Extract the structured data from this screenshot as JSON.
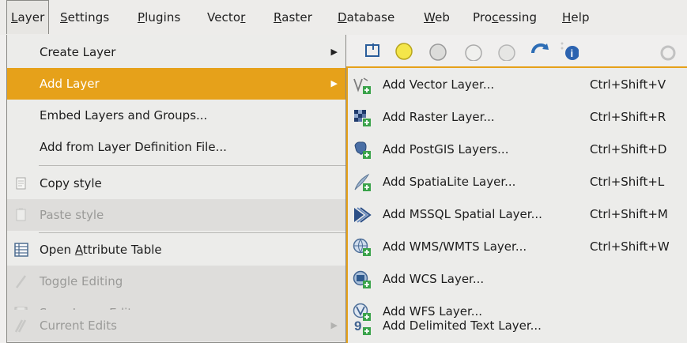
{
  "menubar": {
    "items": [
      {
        "label": "Layer",
        "mn": "L",
        "rest": "ayer",
        "open": true
      },
      {
        "label": "Settings",
        "mn": "S",
        "rest": "ettings"
      },
      {
        "label": "Plugins",
        "mn": "P",
        "rest": "lugins"
      },
      {
        "label": "Vector",
        "pre": "Vecto",
        "mn": "r",
        "rest": ""
      },
      {
        "label": "Raster",
        "mn": "R",
        "rest": "aster"
      },
      {
        "label": "Database",
        "mn": "D",
        "rest": "atabase"
      },
      {
        "label": "Web",
        "mn": "W",
        "rest": "eb"
      },
      {
        "label": "Processing",
        "pre": "Pro",
        "mn": "c",
        "rest": "essing"
      },
      {
        "label": "Help",
        "mn": "H",
        "rest": "elp"
      }
    ]
  },
  "layer_menu": {
    "items": [
      {
        "label": "Create Layer",
        "submenu": true
      },
      {
        "label": "Add Layer",
        "submenu": true,
        "state": "active"
      },
      {
        "label": "Embed Layers and Groups..."
      },
      {
        "label": "Add from Layer Definition File..."
      },
      {
        "label": "Copy style",
        "icon": "copy-style-icon"
      },
      {
        "label": "Paste style",
        "icon": "paste-style-icon",
        "state": "disabled"
      },
      {
        "label_pre": "Open ",
        "label_mn": "A",
        "label_post": "ttribute Table",
        "icon": "attribute-table-icon"
      },
      {
        "label": "Toggle Editing",
        "icon": "pencil-icon",
        "state": "disabled"
      },
      {
        "label": "Save Layer Edits",
        "icon": "save-edits-icon",
        "state": "disabled"
      },
      {
        "label": "Current Edits",
        "icon": "current-edits-icon",
        "state": "disabled",
        "submenu": true
      }
    ]
  },
  "add_layer_submenu": {
    "items": [
      {
        "label": "Add Vector Layer...",
        "shortcut": "Ctrl+Shift+V",
        "icon": "vector-layer-icon"
      },
      {
        "label": "Add Raster Layer...",
        "shortcut": "Ctrl+Shift+R",
        "icon": "raster-layer-icon"
      },
      {
        "label": "Add PostGIS Layers...",
        "shortcut": "Ctrl+Shift+D",
        "icon": "postgis-icon"
      },
      {
        "label": "Add SpatiaLite Layer...",
        "shortcut": "Ctrl+Shift+L",
        "icon": "spatialite-icon"
      },
      {
        "label": "Add MSSQL Spatial Layer...",
        "shortcut": "Ctrl+Shift+M",
        "icon": "mssql-icon"
      },
      {
        "label": "Add WMS/WMTS Layer...",
        "shortcut": "Ctrl+Shift+W",
        "icon": "wms-icon"
      },
      {
        "label": "Add WCS Layer...",
        "shortcut": "",
        "icon": "wcs-icon"
      },
      {
        "label": "Add WFS Layer...",
        "shortcut": "",
        "icon": "wfs-icon"
      },
      {
        "label": "Add Delimited Text Layer...",
        "shortcut": "",
        "icon": "delimited-text-icon"
      }
    ]
  },
  "colors": {
    "accent": "#e6a11a",
    "menu_bg": "#ececea",
    "disabled_text": "#9a9a98"
  }
}
